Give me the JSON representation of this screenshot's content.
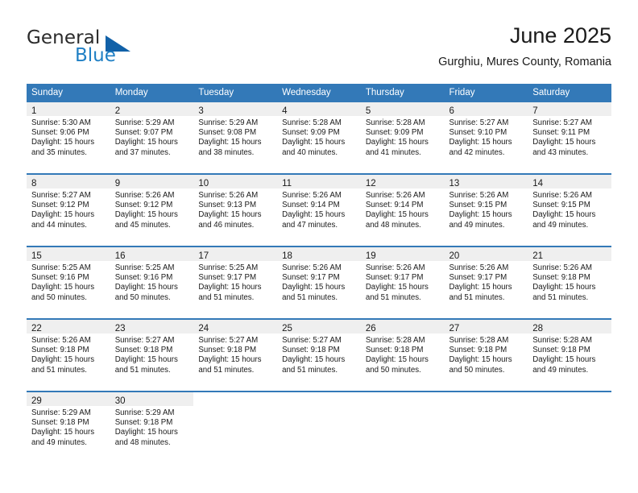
{
  "logo": {
    "word_one": "General",
    "word_two": "Blue",
    "triangle_color": "#1161a8",
    "blue_color": "#1f7fc4"
  },
  "header": {
    "title": "June 2025",
    "subtitle": "Gurghiu, Mures County, Romania"
  },
  "theme": {
    "header_bg": "#3379b8",
    "header_text": "#ffffff",
    "daynum_bg": "#efefef",
    "divider": "#3379b8"
  },
  "weekday_headers": [
    "Sunday",
    "Monday",
    "Tuesday",
    "Wednesday",
    "Thursday",
    "Friday",
    "Saturday"
  ],
  "labels": {
    "sunrise_prefix": "Sunrise:",
    "sunset_prefix": "Sunset:",
    "daylight_prefix": "Daylight:"
  },
  "weeks": [
    [
      {
        "day": "1",
        "sunrise": "Sunrise: 5:30 AM",
        "sunset": "Sunset: 9:06 PM",
        "daylight_l1": "Daylight: 15 hours",
        "daylight_l2": "and 35 minutes."
      },
      {
        "day": "2",
        "sunrise": "Sunrise: 5:29 AM",
        "sunset": "Sunset: 9:07 PM",
        "daylight_l1": "Daylight: 15 hours",
        "daylight_l2": "and 37 minutes."
      },
      {
        "day": "3",
        "sunrise": "Sunrise: 5:29 AM",
        "sunset": "Sunset: 9:08 PM",
        "daylight_l1": "Daylight: 15 hours",
        "daylight_l2": "and 38 minutes."
      },
      {
        "day": "4",
        "sunrise": "Sunrise: 5:28 AM",
        "sunset": "Sunset: 9:09 PM",
        "daylight_l1": "Daylight: 15 hours",
        "daylight_l2": "and 40 minutes."
      },
      {
        "day": "5",
        "sunrise": "Sunrise: 5:28 AM",
        "sunset": "Sunset: 9:09 PM",
        "daylight_l1": "Daylight: 15 hours",
        "daylight_l2": "and 41 minutes."
      },
      {
        "day": "6",
        "sunrise": "Sunrise: 5:27 AM",
        "sunset": "Sunset: 9:10 PM",
        "daylight_l1": "Daylight: 15 hours",
        "daylight_l2": "and 42 minutes."
      },
      {
        "day": "7",
        "sunrise": "Sunrise: 5:27 AM",
        "sunset": "Sunset: 9:11 PM",
        "daylight_l1": "Daylight: 15 hours",
        "daylight_l2": "and 43 minutes."
      }
    ],
    [
      {
        "day": "8",
        "sunrise": "Sunrise: 5:27 AM",
        "sunset": "Sunset: 9:12 PM",
        "daylight_l1": "Daylight: 15 hours",
        "daylight_l2": "and 44 minutes."
      },
      {
        "day": "9",
        "sunrise": "Sunrise: 5:26 AM",
        "sunset": "Sunset: 9:12 PM",
        "daylight_l1": "Daylight: 15 hours",
        "daylight_l2": "and 45 minutes."
      },
      {
        "day": "10",
        "sunrise": "Sunrise: 5:26 AM",
        "sunset": "Sunset: 9:13 PM",
        "daylight_l1": "Daylight: 15 hours",
        "daylight_l2": "and 46 minutes."
      },
      {
        "day": "11",
        "sunrise": "Sunrise: 5:26 AM",
        "sunset": "Sunset: 9:14 PM",
        "daylight_l1": "Daylight: 15 hours",
        "daylight_l2": "and 47 minutes."
      },
      {
        "day": "12",
        "sunrise": "Sunrise: 5:26 AM",
        "sunset": "Sunset: 9:14 PM",
        "daylight_l1": "Daylight: 15 hours",
        "daylight_l2": "and 48 minutes."
      },
      {
        "day": "13",
        "sunrise": "Sunrise: 5:26 AM",
        "sunset": "Sunset: 9:15 PM",
        "daylight_l1": "Daylight: 15 hours",
        "daylight_l2": "and 49 minutes."
      },
      {
        "day": "14",
        "sunrise": "Sunrise: 5:26 AM",
        "sunset": "Sunset: 9:15 PM",
        "daylight_l1": "Daylight: 15 hours",
        "daylight_l2": "and 49 minutes."
      }
    ],
    [
      {
        "day": "15",
        "sunrise": "Sunrise: 5:25 AM",
        "sunset": "Sunset: 9:16 PM",
        "daylight_l1": "Daylight: 15 hours",
        "daylight_l2": "and 50 minutes."
      },
      {
        "day": "16",
        "sunrise": "Sunrise: 5:25 AM",
        "sunset": "Sunset: 9:16 PM",
        "daylight_l1": "Daylight: 15 hours",
        "daylight_l2": "and 50 minutes."
      },
      {
        "day": "17",
        "sunrise": "Sunrise: 5:25 AM",
        "sunset": "Sunset: 9:17 PM",
        "daylight_l1": "Daylight: 15 hours",
        "daylight_l2": "and 51 minutes."
      },
      {
        "day": "18",
        "sunrise": "Sunrise: 5:26 AM",
        "sunset": "Sunset: 9:17 PM",
        "daylight_l1": "Daylight: 15 hours",
        "daylight_l2": "and 51 minutes."
      },
      {
        "day": "19",
        "sunrise": "Sunrise: 5:26 AM",
        "sunset": "Sunset: 9:17 PM",
        "daylight_l1": "Daylight: 15 hours",
        "daylight_l2": "and 51 minutes."
      },
      {
        "day": "20",
        "sunrise": "Sunrise: 5:26 AM",
        "sunset": "Sunset: 9:17 PM",
        "daylight_l1": "Daylight: 15 hours",
        "daylight_l2": "and 51 minutes."
      },
      {
        "day": "21",
        "sunrise": "Sunrise: 5:26 AM",
        "sunset": "Sunset: 9:18 PM",
        "daylight_l1": "Daylight: 15 hours",
        "daylight_l2": "and 51 minutes."
      }
    ],
    [
      {
        "day": "22",
        "sunrise": "Sunrise: 5:26 AM",
        "sunset": "Sunset: 9:18 PM",
        "daylight_l1": "Daylight: 15 hours",
        "daylight_l2": "and 51 minutes."
      },
      {
        "day": "23",
        "sunrise": "Sunrise: 5:27 AM",
        "sunset": "Sunset: 9:18 PM",
        "daylight_l1": "Daylight: 15 hours",
        "daylight_l2": "and 51 minutes."
      },
      {
        "day": "24",
        "sunrise": "Sunrise: 5:27 AM",
        "sunset": "Sunset: 9:18 PM",
        "daylight_l1": "Daylight: 15 hours",
        "daylight_l2": "and 51 minutes."
      },
      {
        "day": "25",
        "sunrise": "Sunrise: 5:27 AM",
        "sunset": "Sunset: 9:18 PM",
        "daylight_l1": "Daylight: 15 hours",
        "daylight_l2": "and 51 minutes."
      },
      {
        "day": "26",
        "sunrise": "Sunrise: 5:28 AM",
        "sunset": "Sunset: 9:18 PM",
        "daylight_l1": "Daylight: 15 hours",
        "daylight_l2": "and 50 minutes."
      },
      {
        "day": "27",
        "sunrise": "Sunrise: 5:28 AM",
        "sunset": "Sunset: 9:18 PM",
        "daylight_l1": "Daylight: 15 hours",
        "daylight_l2": "and 50 minutes."
      },
      {
        "day": "28",
        "sunrise": "Sunrise: 5:28 AM",
        "sunset": "Sunset: 9:18 PM",
        "daylight_l1": "Daylight: 15 hours",
        "daylight_l2": "and 49 minutes."
      }
    ],
    [
      {
        "day": "29",
        "sunrise": "Sunrise: 5:29 AM",
        "sunset": "Sunset: 9:18 PM",
        "daylight_l1": "Daylight: 15 hours",
        "daylight_l2": "and 49 minutes."
      },
      {
        "day": "30",
        "sunrise": "Sunrise: 5:29 AM",
        "sunset": "Sunset: 9:18 PM",
        "daylight_l1": "Daylight: 15 hours",
        "daylight_l2": "and 48 minutes."
      },
      {
        "day": "",
        "sunrise": "",
        "sunset": "",
        "daylight_l1": "",
        "daylight_l2": ""
      },
      {
        "day": "",
        "sunrise": "",
        "sunset": "",
        "daylight_l1": "",
        "daylight_l2": ""
      },
      {
        "day": "",
        "sunrise": "",
        "sunset": "",
        "daylight_l1": "",
        "daylight_l2": ""
      },
      {
        "day": "",
        "sunrise": "",
        "sunset": "",
        "daylight_l1": "",
        "daylight_l2": ""
      },
      {
        "day": "",
        "sunrise": "",
        "sunset": "",
        "daylight_l1": "",
        "daylight_l2": ""
      }
    ]
  ]
}
